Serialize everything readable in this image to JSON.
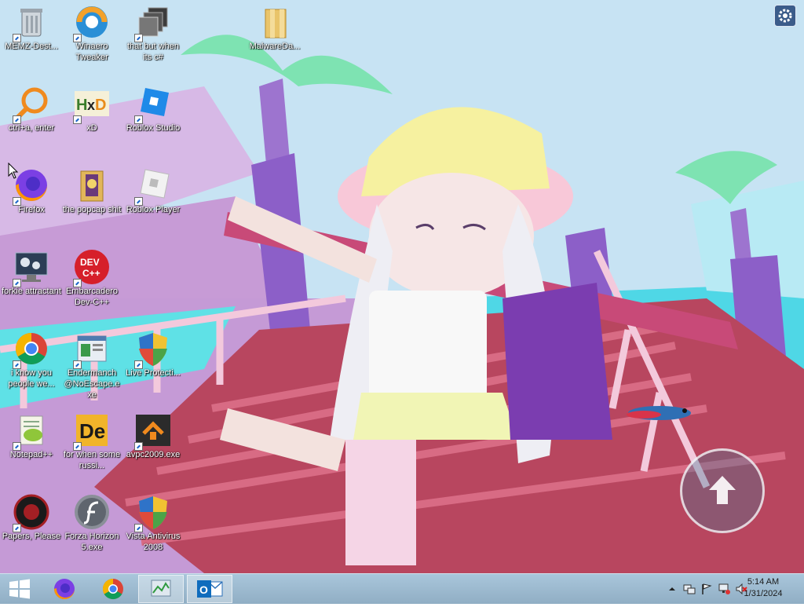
{
  "desktop": {
    "icons": [
      {
        "label": "MEMZ-Dest...",
        "icon": "recycle-bin-icon"
      },
      {
        "label": "Winaero Tweaker",
        "icon": "winaero-tweaker-icon"
      },
      {
        "label": "that but when its c#",
        "icon": "stacked-windows-icon"
      },
      {
        "label": "MalwareDa...",
        "icon": "folder-icon"
      },
      {
        "label": "ctrl+a, enter",
        "icon": "magnifier-app-icon"
      },
      {
        "label": "xD",
        "icon": "hxd-icon"
      },
      {
        "label": "Roblox Studio",
        "icon": "roblox-studio-icon"
      },
      {
        "label": "Firefox",
        "icon": "firefox-icon"
      },
      {
        "label": "the popcap shit",
        "icon": "popcap-folder-icon"
      },
      {
        "label": "Roblox Player",
        "icon": "roblox-player-icon"
      },
      {
        "label": "forkie attractant",
        "icon": "monitor-gear-icon"
      },
      {
        "label": "Embarcadero Dev-C++",
        "icon": "dev-cpp-icon"
      },
      {
        "label": "i know you people we...",
        "icon": "chrome-icon"
      },
      {
        "label": "Endermanch @NoEscape.exe",
        "icon": "window-app-icon"
      },
      {
        "label": "Live Protecti...",
        "icon": "security-shield-icon"
      },
      {
        "label": "Notepad++",
        "icon": "notepad-plus-plus-icon"
      },
      {
        "label": "for when some russi...",
        "icon": "de-app-icon"
      },
      {
        "label": "avpc2009.exe",
        "icon": "avpc-house-icon"
      },
      {
        "label": "Papers, Please",
        "icon": "papers-please-icon"
      },
      {
        "label": "Forza Horizon 5.exe",
        "icon": "flash-player-icon"
      },
      {
        "label": "Vista Antivirus 2008",
        "icon": "security-shield-icon"
      }
    ]
  },
  "overlay": {
    "settings_icon": "gear-icon",
    "jump_icon": "up-arrow-icon"
  },
  "taskbar": {
    "start_icon": "windows-start-icon",
    "pinned": [
      "firefox-icon",
      "chrome-icon",
      "task-manager-icon",
      "outlook-icon"
    ],
    "tray_icons": [
      "show-hidden-icons-chevron",
      "network-icon",
      "action-center-flag-icon",
      "network-status-icon",
      "volume-muted-icon"
    ],
    "time": "5:14 AM",
    "date": "1/31/2024"
  },
  "colors": {
    "taskbar": "#9fbcd1",
    "label_text": "#ffffff"
  }
}
